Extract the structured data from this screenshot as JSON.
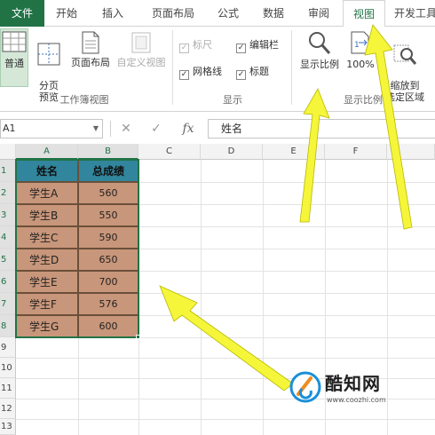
{
  "tabs": [
    {
      "label": "文件"
    },
    {
      "label": "开始"
    },
    {
      "label": "插入"
    },
    {
      "label": "页面布局"
    },
    {
      "label": "公式"
    },
    {
      "label": "数据"
    },
    {
      "label": "审阅"
    },
    {
      "label": "视图"
    },
    {
      "label": "开发工具"
    }
  ],
  "ribbon": {
    "workbook_views": {
      "group_label": "工作簿视图",
      "normal": "普通",
      "page_break": "分页\n预览",
      "page_layout": "页面布局",
      "custom_view": "自定义视图"
    },
    "show": {
      "group_label": "显示",
      "ruler": "标尺",
      "formula_bar": "编辑栏",
      "gridlines": "网格线",
      "headings": "标题"
    },
    "zoom": {
      "group_label": "显示比例",
      "zoom": "显示比例",
      "zoom_100": "100%",
      "zoom_selection": "缩放到\n选定区域"
    }
  },
  "formula_bar": {
    "name_box": "A1",
    "cancel_icon": "✕",
    "enter_icon": "✓",
    "fx": "fx",
    "value": "姓名"
  },
  "columns": [
    "A",
    "B",
    "C",
    "D",
    "E",
    "F"
  ],
  "rows": [
    "1",
    "2",
    "3",
    "4",
    "5",
    "6",
    "7",
    "8",
    "9",
    "10",
    "11",
    "12",
    "13"
  ],
  "table": {
    "headers": [
      "姓名",
      "总成绩"
    ],
    "rows": [
      [
        "学生A",
        "560"
      ],
      [
        "学生B",
        "550"
      ],
      [
        "学生C",
        "590"
      ],
      [
        "学生D",
        "650"
      ],
      [
        "学生E",
        "700"
      ],
      [
        "学生F",
        "576"
      ],
      [
        "学生G",
        "600"
      ]
    ]
  },
  "watermark": {
    "brand": "酷知网",
    "url": "www.coozhi.com"
  },
  "colors": {
    "accent": "#217346",
    "header_fill": "#31859c",
    "body_fill": "#c8967a",
    "arrow": "#f5f53a"
  }
}
